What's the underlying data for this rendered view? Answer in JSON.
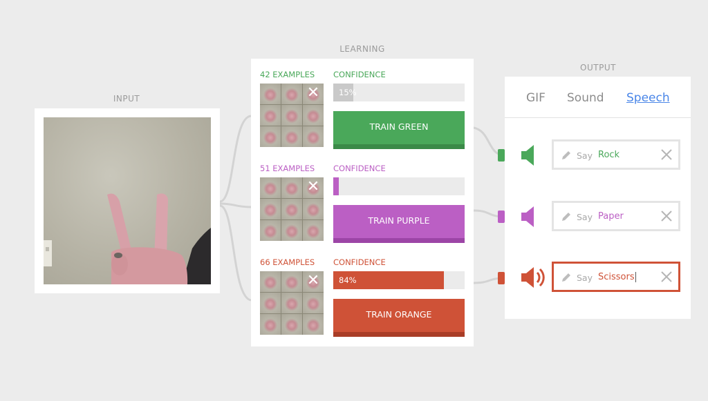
{
  "sections": {
    "input_title": "INPUT",
    "learning_title": "LEARNING",
    "output_title": "OUTPUT"
  },
  "colors": {
    "green": "#4aa85a",
    "green_dark": "#3b8a48",
    "purple": "#bb5fc4",
    "purple_dark": "#9c45a6",
    "orange": "#cf5237",
    "orange_dark": "#a93d27",
    "wire": "#d3d3d3",
    "link": "#4a86e8"
  },
  "input": {
    "camera_icon": "webcam-feed"
  },
  "learning": {
    "classes": [
      {
        "examples": "42 EXAMPLES",
        "confidence_label": "CONFIDENCE",
        "confidence_text": "15%",
        "confidence": 0.15,
        "button": "TRAIN GREEN",
        "remove_icon": "close-icon"
      },
      {
        "examples": "51 EXAMPLES",
        "confidence_label": "CONFIDENCE",
        "confidence_text": "",
        "confidence": 0,
        "button": "TRAIN PURPLE",
        "remove_icon": "close-icon"
      },
      {
        "examples": "66 EXAMPLES",
        "confidence_label": "CONFIDENCE",
        "confidence_text": "84%",
        "confidence": 0.84,
        "button": "TRAIN ORANGE",
        "remove_icon": "close-icon"
      }
    ]
  },
  "output": {
    "tabs": [
      "GIF",
      "Sound",
      "Speech"
    ],
    "active_tab": "Speech",
    "rows": [
      {
        "say_label": "Say",
        "value": "Rock",
        "icon": "speaker-icon",
        "active": false
      },
      {
        "say_label": "Say",
        "value": "Paper",
        "icon": "speaker-icon",
        "active": false
      },
      {
        "say_label": "Say",
        "value": "Scissors",
        "icon": "speaker-loud-icon",
        "active": true
      }
    ]
  }
}
